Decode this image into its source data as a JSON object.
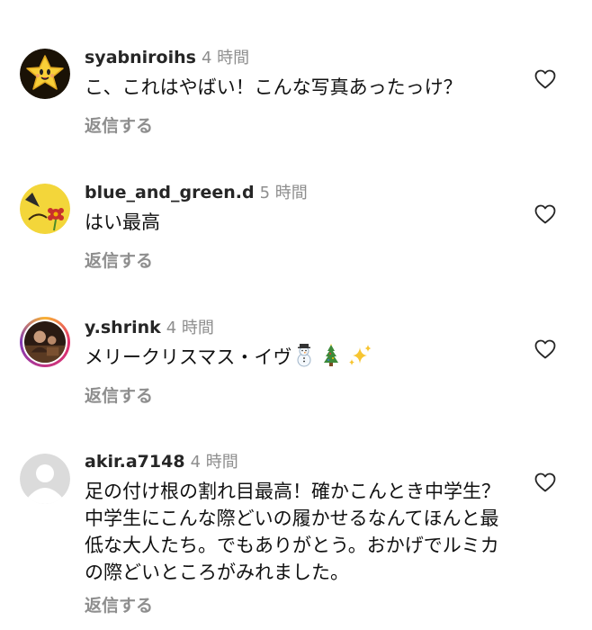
{
  "comments": [
    {
      "username": "syabniroihs",
      "time": "4 時間",
      "text": "こ、これはやばい！こんな写真あったっけ？",
      "reply_label": "返信する",
      "avatar_icon": "star-character-icon"
    },
    {
      "username": "blue_and_green.d",
      "time": "5 時間",
      "text": "はい最高",
      "reply_label": "返信する",
      "avatar_icon": "pikachu-with-flower-icon"
    },
    {
      "username": "y.shrink",
      "time": "4 時間",
      "text": "メリークリスマス・イヴ",
      "emojis": [
        "snowman-emoji",
        "christmas-tree-emoji",
        "sparkles-emoji"
      ],
      "reply_label": "返信する",
      "avatar_icon": "photo-avatar",
      "has_story_ring": true
    },
    {
      "username": "akir.a7148",
      "time": "4 時間",
      "text": "足の付け根の割れ目最高！確かこんとき中学生？中学生にこんな際どいの履かせるなんてほんと最低な大人たち。でもありがとう。おかげでルミカの際どいところがみれました。",
      "reply_label": "返信する",
      "avatar_icon": "default-user-icon"
    }
  ],
  "colors": {
    "username": "#262626",
    "secondary": "#8e8e8e",
    "text": "#111111",
    "story_ring": "#e1306c"
  }
}
